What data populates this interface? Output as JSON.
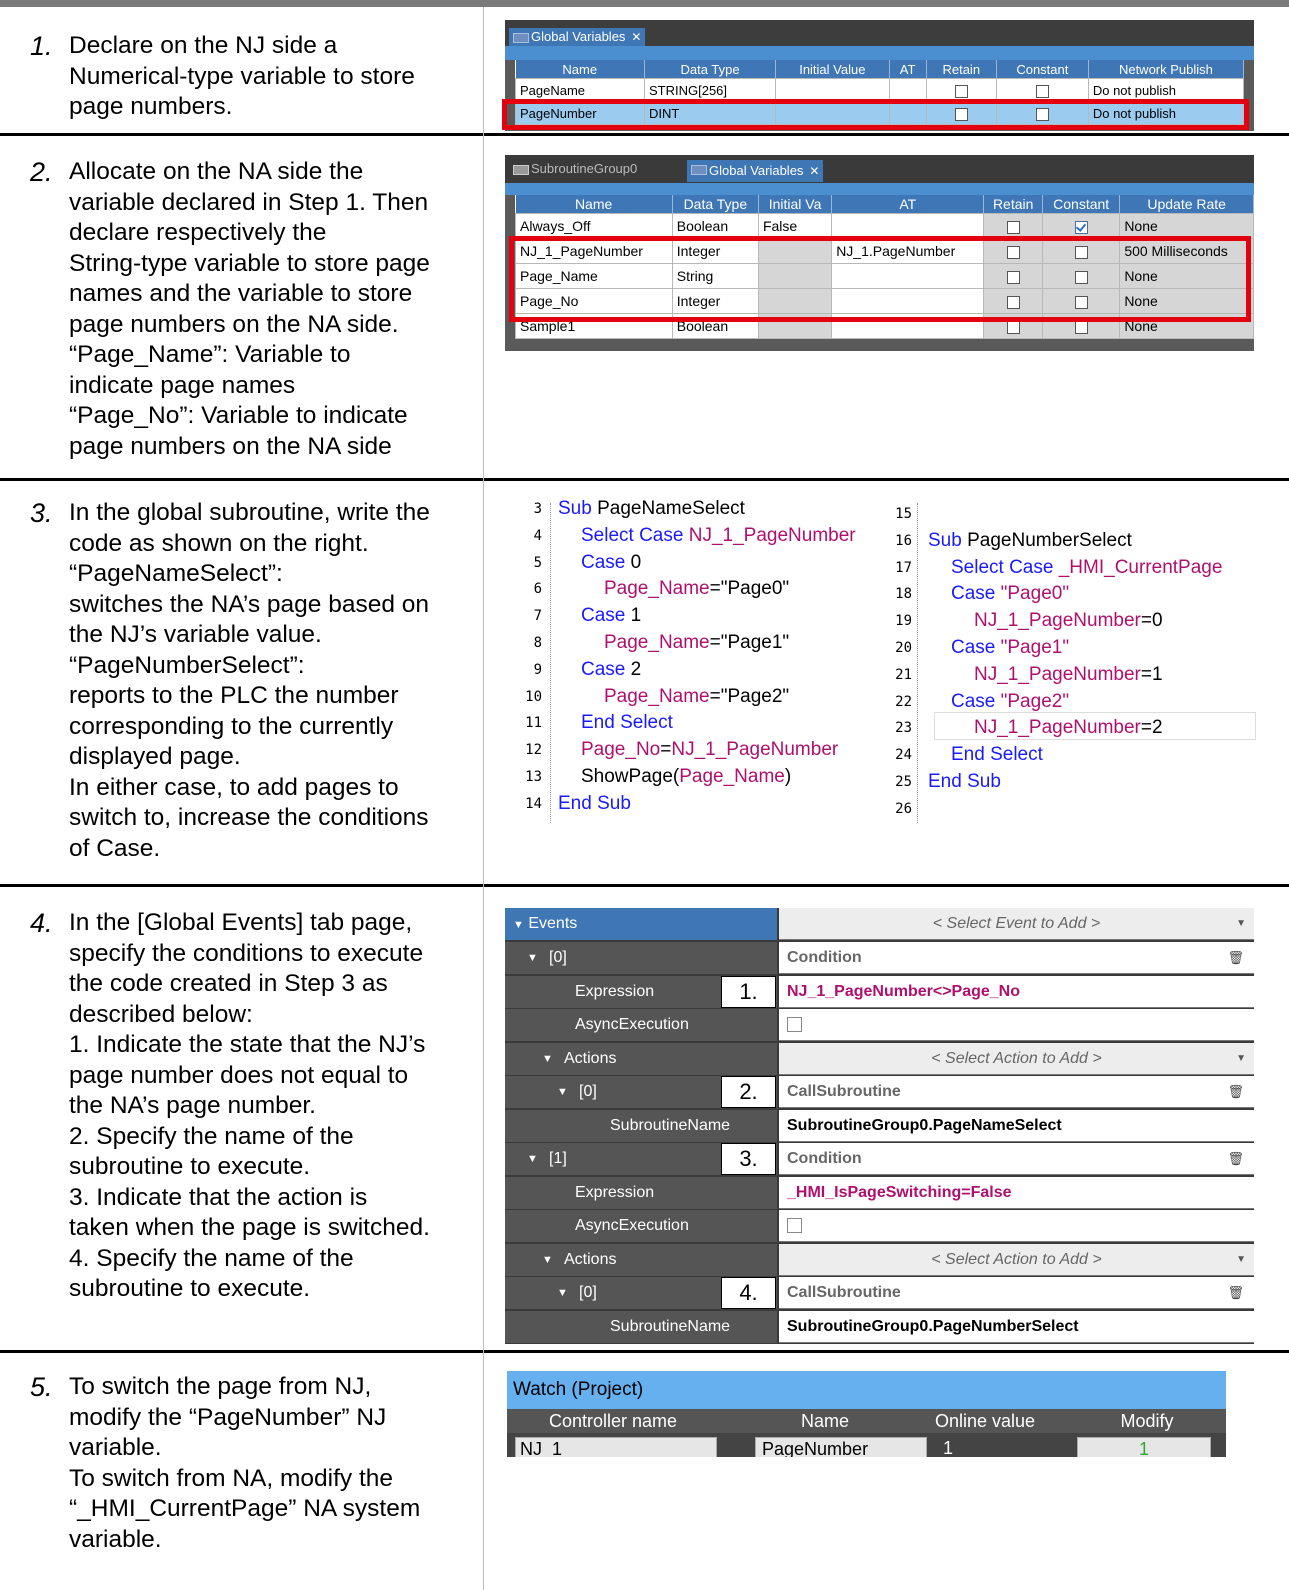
{
  "steps": [
    {
      "number": "1.",
      "lines": [
        "Declare on the NJ side a",
        "Numerical-type variable to store",
        "page numbers."
      ]
    },
    {
      "number": "2.",
      "lines": [
        "Allocate on the NA side the",
        "variable declared in Step 1. Then",
        "declare respectively the",
        "String-type variable to store page",
        "names and the variable to store",
        "page numbers on the NA side.",
        "“Page_Name”: Variable to",
        "indicate page names",
        "“Page_No”: Variable to indicate",
        "page numbers on the NA side"
      ]
    },
    {
      "number": "3.",
      "lines": [
        "In the global subroutine, write the",
        "code as shown on the right.",
        "“PageNameSelect”:",
        "switches the NA’s page based on",
        "the NJ’s variable value.",
        "“PageNumberSelect”:",
        "reports to the PLC the number",
        "corresponding to the currently",
        "displayed page.",
        "In either case, to add pages to",
        "switch to, increase the conditions",
        "of Case."
      ]
    },
    {
      "number": "4.",
      "lines": [
        "In the [Global Events] tab page,",
        "specify the conditions to execute",
        "the code created in Step 3 as",
        "described below:",
        "1. Indicate the state that the NJ’s",
        "page number does not equal to",
        "the NA’s page number.",
        "2. Specify the name of the",
        "subroutine to execute.",
        "3. Indicate that the action is",
        "taken when the page is switched.",
        "4. Specify the name of the",
        "subroutine to execute."
      ]
    },
    {
      "number": "5.",
      "lines": [
        "To switch the page from NJ,",
        "modify the “PageNumber” NJ",
        "variable.",
        "To switch from NA, modify the",
        "“_HMI_CurrentPage” NA system",
        "variable."
      ]
    }
  ],
  "nj_panel": {
    "tab": "Global Variables",
    "columns": [
      "Name",
      "Data Type",
      "Initial Value",
      "AT",
      "Retain",
      "Constant",
      "Network Publish"
    ],
    "rows": [
      {
        "name": "PageName",
        "type": "STRING[256]",
        "initial": "",
        "at": "",
        "retain": false,
        "constant": false,
        "publish": "Do not publish"
      },
      {
        "name": "PageNumber",
        "type": "DINT",
        "initial": "",
        "at": "",
        "retain": false,
        "constant": false,
        "publish": "Do not publish"
      }
    ]
  },
  "na_panel": {
    "tab_inactive": "SubroutineGroup0",
    "tab_active": "Global Variables",
    "columns": [
      "Name",
      "Data Type",
      "Initial Va",
      "AT",
      "Retain",
      "Constant",
      "Update Rate"
    ],
    "rows": [
      {
        "name": "Always_Off",
        "type": "Boolean",
        "initial": "False",
        "at": "",
        "retain": false,
        "constant": true,
        "rate": "None"
      },
      {
        "name": "NJ_1_PageNumber",
        "type": "Integer",
        "initial": "",
        "at": "NJ_1.PageNumber",
        "retain": false,
        "constant": false,
        "rate": "500 Milliseconds"
      },
      {
        "name": "Page_Name",
        "type": "String",
        "initial": "",
        "at": "",
        "retain": false,
        "constant": false,
        "rate": "None"
      },
      {
        "name": "Page_No",
        "type": "Integer",
        "initial": "",
        "at": "",
        "retain": false,
        "constant": false,
        "rate": "None"
      },
      {
        "name": "Sample1",
        "type": "Boolean",
        "initial": "",
        "at": "",
        "retain": false,
        "constant": false,
        "rate": "None"
      }
    ]
  },
  "code_left": [
    {
      "n": "3",
      "parts": [
        [
          "kw",
          "Sub "
        ],
        [
          "tx",
          "PageNameSelect"
        ]
      ],
      "indent": 0
    },
    {
      "n": "4",
      "parts": [
        [
          "kw",
          "Select Case "
        ],
        [
          "vr",
          "NJ_1_PageNumber"
        ]
      ],
      "indent": 1
    },
    {
      "n": "5",
      "parts": [
        [
          "kw",
          "Case "
        ],
        [
          "tx",
          "0"
        ]
      ],
      "indent": 1
    },
    {
      "n": "6",
      "parts": [
        [
          "vr",
          "Page_Name"
        ],
        [
          "tx",
          "=\"Page0\""
        ]
      ],
      "indent": 2
    },
    {
      "n": "7",
      "parts": [
        [
          "kw",
          "Case "
        ],
        [
          "tx",
          "1"
        ]
      ],
      "indent": 1
    },
    {
      "n": "8",
      "parts": [
        [
          "vr",
          "Page_Name"
        ],
        [
          "tx",
          "=\"Page1\""
        ]
      ],
      "indent": 2
    },
    {
      "n": "9",
      "parts": [
        [
          "kw",
          "Case "
        ],
        [
          "tx",
          "2"
        ]
      ],
      "indent": 1
    },
    {
      "n": "10",
      "parts": [
        [
          "vr",
          "Page_Name"
        ],
        [
          "tx",
          "=\"Page2\""
        ]
      ],
      "indent": 2
    },
    {
      "n": "11",
      "parts": [
        [
          "kw",
          "End Select"
        ]
      ],
      "indent": 1
    },
    {
      "n": "12",
      "parts": [
        [
          "vr",
          "Page_No"
        ],
        [
          "tx",
          "="
        ],
        [
          "vr",
          "NJ_1_PageNumber"
        ]
      ],
      "indent": 1
    },
    {
      "n": "13",
      "parts": [
        [
          "tx",
          "ShowPage("
        ],
        [
          "vr",
          "Page_Name"
        ],
        [
          "tx",
          ")"
        ]
      ],
      "indent": 1
    },
    {
      "n": "14",
      "parts": [
        [
          "kw",
          "End Sub"
        ]
      ],
      "indent": 0
    }
  ],
  "code_right": [
    {
      "n": "15",
      "parts": [],
      "indent": 0
    },
    {
      "n": "16",
      "parts": [
        [
          "kw",
          "Sub "
        ],
        [
          "tx",
          "PageNumberSelect"
        ]
      ],
      "indent": 0
    },
    {
      "n": "17",
      "parts": [
        [
          "kw",
          "Select Case "
        ],
        [
          "vr",
          "_HMI_CurrentPage"
        ]
      ],
      "indent": 1
    },
    {
      "n": "18",
      "parts": [
        [
          "kw",
          "Case "
        ],
        [
          "vr",
          "\"Page0\""
        ]
      ],
      "indent": 1
    },
    {
      "n": "19",
      "parts": [
        [
          "vr",
          "NJ_1_PageNumber"
        ],
        [
          "tx",
          "=0"
        ]
      ],
      "indent": 2
    },
    {
      "n": "20",
      "parts": [
        [
          "kw",
          "Case "
        ],
        [
          "vr",
          "\"Page1\""
        ]
      ],
      "indent": 1
    },
    {
      "n": "21",
      "parts": [
        [
          "vr",
          "NJ_1_PageNumber"
        ],
        [
          "tx",
          "=1"
        ]
      ],
      "indent": 2
    },
    {
      "n": "22",
      "parts": [
        [
          "kw",
          "Case "
        ],
        [
          "vr",
          "\"Page2\""
        ]
      ],
      "indent": 1
    },
    {
      "n": "23",
      "parts": [
        [
          "vr",
          "NJ_1_PageNumber"
        ],
        [
          "tx",
          "=2"
        ]
      ],
      "indent": 2
    },
    {
      "n": "24",
      "parts": [
        [
          "kw",
          "End Select"
        ]
      ],
      "indent": 1
    },
    {
      "n": "25",
      "parts": [
        [
          "kw",
          "End Sub"
        ]
      ],
      "indent": 0
    },
    {
      "n": "26",
      "parts": [],
      "indent": 0
    }
  ],
  "events": {
    "header": "Events",
    "select_event": "< Select Event to Add >",
    "select_action": "< Select Action to Add >",
    "rows": [
      {
        "label": "[0]",
        "value": "Condition",
        "kind": "cond"
      },
      {
        "label": "Expression",
        "value": "NJ_1_PageNumber<>Page_No",
        "kind": "expr"
      },
      {
        "label": "AsyncExecution",
        "value": "",
        "kind": "check"
      },
      {
        "label": "Actions",
        "value": "",
        "kind": "actions"
      },
      {
        "label": "[0]",
        "value": "CallSubroutine",
        "kind": "cond"
      },
      {
        "label": "SubroutineName",
        "value": "SubroutineGroup0.PageNameSelect",
        "kind": "bold"
      },
      {
        "label": "[1]",
        "value": "Condition",
        "kind": "cond"
      },
      {
        "label": "Expression",
        "value": "_HMI_IsPageSwitching=False",
        "kind": "expr"
      },
      {
        "label": "AsyncExecution",
        "value": "",
        "kind": "check"
      },
      {
        "label": "Actions",
        "value": "",
        "kind": "actions"
      },
      {
        "label": "[0]",
        "value": "CallSubroutine",
        "kind": "cond"
      },
      {
        "label": "SubroutineName",
        "value": "SubroutineGroup0.PageNumberSelect",
        "kind": "bold"
      }
    ],
    "callouts": [
      "1.",
      "2.",
      "3.",
      "4."
    ]
  },
  "watch": {
    "title": "Watch (Project)",
    "columns": [
      "Controller name",
      "Name",
      "Online value",
      "Modify"
    ],
    "row": {
      "controller": "NJ_1",
      "name": "PageNumber",
      "online": "1",
      "modify": "1"
    }
  }
}
